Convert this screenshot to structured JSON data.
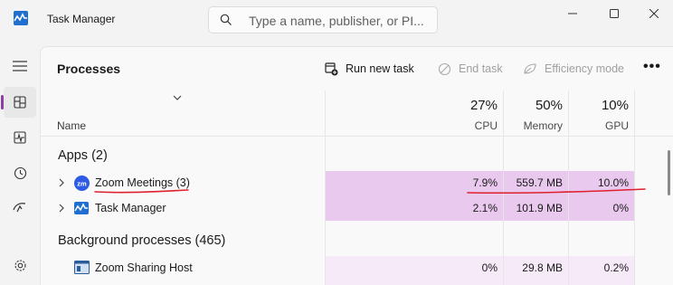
{
  "app": {
    "title": "Task Manager"
  },
  "search": {
    "placeholder": "Type a name, publisher, or PI..."
  },
  "page": {
    "title": "Processes"
  },
  "toolbar": {
    "run_new_task": "Run new task",
    "end_task": "End task",
    "efficiency_mode": "Efficiency mode",
    "more": "•••"
  },
  "columns": {
    "name": "Name",
    "cpu": {
      "percent": "27%",
      "label": "CPU"
    },
    "memory": {
      "percent": "50%",
      "label": "Memory"
    },
    "gpu": {
      "percent": "10%",
      "label": "GPU"
    }
  },
  "groups": {
    "apps": "Apps (2)",
    "background": "Background processes (465)"
  },
  "rows": [
    {
      "name": "Zoom Meetings (3)",
      "cpu": "7.9%",
      "memory": "559.7 MB",
      "gpu": "10.0%",
      "icon": "zoom-icon"
    },
    {
      "name": "Task Manager",
      "cpu": "2.1%",
      "memory": "101.9 MB",
      "gpu": "0%",
      "icon": "task-manager-icon"
    },
    {
      "name": "Zoom Sharing Host",
      "cpu": "0%",
      "memory": "29.8 MB",
      "gpu": "0.2%",
      "icon": "window-icon"
    }
  ],
  "colors": {
    "accent": "#8a3fa8",
    "heat_strong": "#e9c9ee",
    "heat_light": "#f6e9f8",
    "annotation": "#e0202e"
  }
}
